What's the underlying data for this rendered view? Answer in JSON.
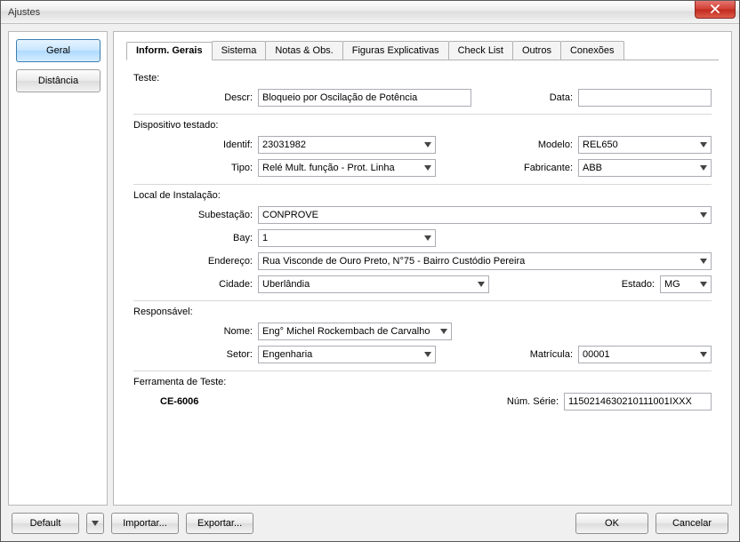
{
  "window": {
    "title": "Ajustes"
  },
  "sidebar": {
    "items": [
      {
        "label": "Geral"
      },
      {
        "label": "Distância"
      }
    ]
  },
  "tabs": [
    {
      "label": "Inform. Gerais"
    },
    {
      "label": "Sistema"
    },
    {
      "label": "Notas & Obs."
    },
    {
      "label": "Figuras Explicativas"
    },
    {
      "label": "Check List"
    },
    {
      "label": "Outros"
    },
    {
      "label": "Conexões"
    }
  ],
  "teste": {
    "section": "Teste:",
    "descr_label": "Descr:",
    "descr": "Bloqueio por Oscilação de Potência",
    "data_label": "Data:",
    "data": ""
  },
  "dispositivo": {
    "section": "Dispositivo testado:",
    "identif_label": "Identif:",
    "identif": "23031982",
    "modelo_label": "Modelo:",
    "modelo": "REL650",
    "tipo_label": "Tipo:",
    "tipo": "Relé Mult. função - Prot. Linha",
    "fabricante_label": "Fabricante:",
    "fabricante": "ABB"
  },
  "local": {
    "section": "Local de Instalação:",
    "subestacao_label": "Subestação:",
    "subestacao": "CONPROVE",
    "bay_label": "Bay:",
    "bay": "1",
    "endereco_label": "Endereço:",
    "endereco": "Rua Visconde de Ouro Preto, N°75 - Bairro Custódio Pereira",
    "cidade_label": "Cidade:",
    "cidade": "Uberlândia",
    "estado_label": "Estado:",
    "estado": "MG"
  },
  "responsavel": {
    "section": "Responsável:",
    "nome_label": "Nome:",
    "nome": "Eng° Michel Rockembach de Carvalho",
    "setor_label": "Setor:",
    "setor": "Engenharia",
    "matricula_label": "Matrícula:",
    "matricula": "00001"
  },
  "ferramenta": {
    "section": "Ferramenta de Teste:",
    "device": "CE-6006",
    "num_serie_label": "Núm. Série:",
    "num_serie": "1150214630210111001IXXX"
  },
  "buttons": {
    "default": "Default",
    "importar": "Importar...",
    "exportar": "Exportar...",
    "ok": "OK",
    "cancelar": "Cancelar"
  }
}
